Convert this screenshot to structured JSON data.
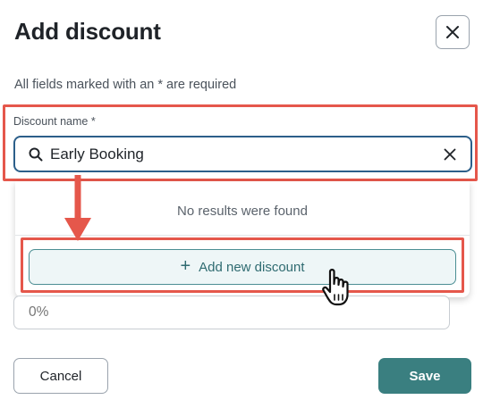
{
  "dialog": {
    "title": "Add discount",
    "required_note": "All fields marked with an * are required"
  },
  "discount_name": {
    "label": "Discount name *",
    "value": "Early Booking",
    "search_icon": "search-icon",
    "clear_icon": "close-icon"
  },
  "dropdown": {
    "no_results": "No results were found",
    "add_new_label": "Add new discount",
    "add_icon": "plus-icon"
  },
  "discount_value": {
    "placeholder": "0%"
  },
  "footer": {
    "cancel_label": "Cancel",
    "save_label": "Save"
  },
  "colors": {
    "annotation_highlight": "#e5574b",
    "primary_button": "#3a7f80",
    "input_focus_border": "#2c5f8a"
  }
}
